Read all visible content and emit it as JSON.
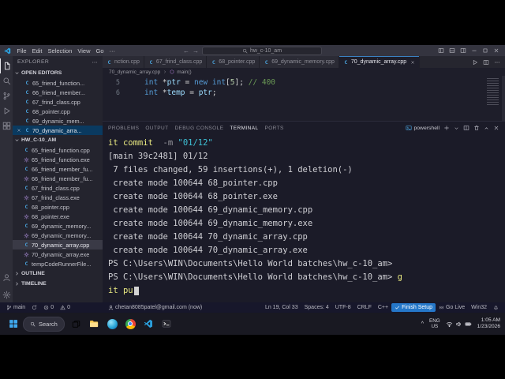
{
  "colors": {
    "accent_blue": "#2577c8",
    "tab_accent": "#3b82c4",
    "cpp_icon_blue": "#4aa3dd",
    "terminal_command_yellow": "#e9e981",
    "terminal_string_cyan": "#3ec1d6"
  },
  "title_bar": {
    "menus": [
      "File",
      "Edit",
      "Selection",
      "View",
      "Go"
    ],
    "more_menu": "···",
    "nav_back": "←",
    "nav_forward": "→",
    "search_value": "hw_c-10_am"
  },
  "activity_bar": {
    "items": [
      {
        "name": "explorer",
        "icon": "files",
        "active": true
      },
      {
        "name": "search",
        "icon": "search",
        "active": false
      },
      {
        "name": "source-control",
        "icon": "git",
        "active": false
      },
      {
        "name": "run-debug",
        "icon": "run",
        "active": false
      },
      {
        "name": "extensions",
        "icon": "extensions",
        "active": false
      }
    ],
    "bottom": [
      {
        "name": "account",
        "icon": "account"
      },
      {
        "name": "settings",
        "icon": "gear"
      }
    ]
  },
  "sidebar": {
    "title": "EXPLORER",
    "open_editors": {
      "header": "OPEN EDITORS",
      "items": [
        {
          "label": "65_friend_function...",
          "type": "cpp",
          "active": false
        },
        {
          "label": "66_friend_member...",
          "type": "cpp",
          "active": false
        },
        {
          "label": "67_frind_class.cpp",
          "type": "cpp",
          "active": false
        },
        {
          "label": "68_pointer.cpp",
          "type": "cpp",
          "active": false
        },
        {
          "label": "69_dynamic_mem...",
          "type": "cpp",
          "active": false
        },
        {
          "label": "70_dynamic_arra...",
          "type": "cpp",
          "active": true
        }
      ]
    },
    "folder": {
      "header": "HW_C-10_AM",
      "items": [
        {
          "label": "65_friend_function.cpp",
          "type": "cpp",
          "selected": false
        },
        {
          "label": "65_friend_function.exe",
          "type": "exe",
          "selected": false
        },
        {
          "label": "66_friend_member_fu...",
          "type": "cpp",
          "selected": false
        },
        {
          "label": "66_friend_member_fu...",
          "type": "exe",
          "selected": false
        },
        {
          "label": "67_frind_class.cpp",
          "type": "cpp",
          "selected": false
        },
        {
          "label": "67_frind_class.exe",
          "type": "exe",
          "selected": false
        },
        {
          "label": "68_pointer.cpp",
          "type": "cpp",
          "selected": false
        },
        {
          "label": "68_pointer.exe",
          "type": "exe",
          "selected": false
        },
        {
          "label": "69_dynamic_memory...",
          "type": "cpp",
          "selected": false
        },
        {
          "label": "69_dynamic_memory...",
          "type": "exe",
          "selected": false
        },
        {
          "label": "70_dynamic_array.cpp",
          "type": "cpp",
          "selected": true
        },
        {
          "label": "70_dynamic_array.exe",
          "type": "exe",
          "selected": false
        },
        {
          "label": "tempCodeRunnerFile...",
          "type": "cpp",
          "selected": false
        }
      ]
    },
    "collapsed_sections": [
      "OUTLINE",
      "TIMELINE"
    ]
  },
  "editor_tabs": [
    {
      "label": "nction.cpp",
      "active": false
    },
    {
      "label": "67_frind_class.cpp",
      "active": false
    },
    {
      "label": "68_pointer.cpp",
      "active": false
    },
    {
      "label": "69_dynamic_memory.cpp",
      "active": false
    },
    {
      "label": "70_dynamic_array.cpp",
      "active": true
    }
  ],
  "breadcrumb": {
    "file": "70_dynamic_array.cpp",
    "symbol": "main()"
  },
  "editor": {
    "lines": [
      {
        "num": "5",
        "tokens": [
          {
            "t": "int",
            "c": "kw"
          },
          {
            "t": " *",
            "c": "pl"
          },
          {
            "t": "ptr",
            "c": "var"
          },
          {
            "t": " = ",
            "c": "pl"
          },
          {
            "t": "new",
            "c": "kw"
          },
          {
            "t": " ",
            "c": "pl"
          },
          {
            "t": "int",
            "c": "kw"
          },
          {
            "t": "[",
            "c": "pl"
          },
          {
            "t": "5",
            "c": "num"
          },
          {
            "t": "]; ",
            "c": "pl"
          },
          {
            "t": "// 400",
            "c": "com"
          }
        ]
      },
      {
        "num": "6",
        "tokens": [
          {
            "t": "int",
            "c": "kw"
          },
          {
            "t": " *",
            "c": "pl"
          },
          {
            "t": "temp",
            "c": "var"
          },
          {
            "t": " = ",
            "c": "pl"
          },
          {
            "t": "ptr",
            "c": "var"
          },
          {
            "t": ";",
            "c": "pl"
          }
        ]
      }
    ]
  },
  "panel": {
    "tabs": [
      {
        "label": "PROBLEMS",
        "active": false
      },
      {
        "label": "OUTPUT",
        "active": false
      },
      {
        "label": "DEBUG CONSOLE",
        "active": false
      },
      {
        "label": "TERMINAL",
        "active": true
      },
      {
        "label": "PORTS",
        "active": false
      }
    ],
    "shell_label": "powershell"
  },
  "terminal": {
    "lines": [
      {
        "tokens": [
          {
            "t": "it commit ",
            "c": "cmd"
          },
          {
            "t": " -m ",
            "c": "par"
          },
          {
            "t": "\"01/12\"",
            "c": "str"
          }
        ]
      },
      {
        "tokens": [
          {
            "t": "[main 39c2481] 01/12",
            "c": "out"
          }
        ]
      },
      {
        "tokens": [
          {
            "t": " 7 files changed, 59 insertions(+), 1 deletion(-)",
            "c": "out"
          }
        ]
      },
      {
        "tokens": [
          {
            "t": " create mode 100644 68_pointer.cpp",
            "c": "out"
          }
        ]
      },
      {
        "tokens": [
          {
            "t": " create mode 100644 68_pointer.exe",
            "c": "out"
          }
        ]
      },
      {
        "tokens": [
          {
            "t": " create mode 100644 69_dynamic_memory.cpp",
            "c": "out"
          }
        ]
      },
      {
        "tokens": [
          {
            "t": " create mode 100644 69_dynamic_memory.exe",
            "c": "out"
          }
        ]
      },
      {
        "tokens": [
          {
            "t": " create mode 100644 70_dynamic_array.cpp",
            "c": "out"
          }
        ]
      },
      {
        "tokens": [
          {
            "t": " create mode 100644 70_dynamic_array.exe",
            "c": "out"
          }
        ]
      },
      {
        "tokens": [
          {
            "t": "PS C:\\Users\\WIN\\Documents\\Hello World batches\\hw_c-10_am>",
            "c": "out"
          }
        ]
      },
      {
        "tokens": [
          {
            "t": "PS C:\\Users\\WIN\\Documents\\Hello World batches\\hw_c-10_am> ",
            "c": "out"
          },
          {
            "t": "g",
            "c": "cmd"
          }
        ]
      },
      {
        "tokens": [
          {
            "t": "it pu",
            "c": "cmd"
          }
        ],
        "cursor": true
      }
    ]
  },
  "status_bar": {
    "left": [
      {
        "name": "branch-status",
        "icon": "branch",
        "label": "main"
      },
      {
        "name": "sync-status",
        "icon": "sync",
        "label": ""
      },
      {
        "name": "errors",
        "icon": "error",
        "label": "0"
      },
      {
        "name": "warnings",
        "icon": "warning",
        "label": "0"
      },
      {
        "name": "account-sync",
        "icon": "account",
        "label": "chetan8085patel@gmail.com (now)",
        "account": true
      }
    ],
    "right": [
      {
        "name": "cursor-position",
        "label": "Ln 19, Col 33"
      },
      {
        "name": "indentation",
        "label": "Spaces: 4"
      },
      {
        "name": "encoding",
        "label": "UTF-8"
      },
      {
        "name": "eol",
        "label": "CRLF"
      },
      {
        "name": "language-mode",
        "label": "C++"
      },
      {
        "name": "finish-setup",
        "icon": "check",
        "label": "Finish Setup",
        "style": "primary"
      },
      {
        "name": "go-live",
        "icon": "broadcast",
        "label": "Go Live"
      },
      {
        "name": "platform",
        "label": "Win32"
      },
      {
        "name": "notifications",
        "icon": "bell",
        "label": ""
      }
    ]
  },
  "taskbar": {
    "search_label": "Search",
    "icons": [
      {
        "name": "task-view"
      },
      {
        "name": "file-explorer"
      },
      {
        "name": "edge"
      },
      {
        "name": "chrome"
      },
      {
        "name": "vscode"
      },
      {
        "name": "terminal"
      }
    ],
    "tray": {
      "chevron": "^",
      "lang_line1": "ENG",
      "lang_line2": "US",
      "time": "1:05 AM",
      "date": "1/23/2026"
    }
  }
}
